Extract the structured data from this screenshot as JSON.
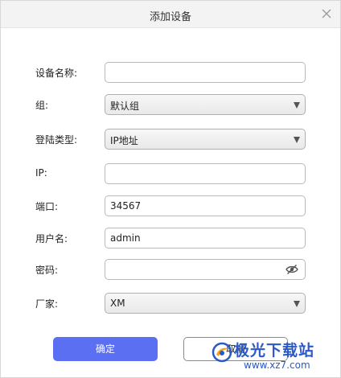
{
  "dialog": {
    "title": "添加设备"
  },
  "form": {
    "device_name": {
      "label": "设备名称:",
      "value": ""
    },
    "group": {
      "label": "组:",
      "value": "默认组"
    },
    "login_type": {
      "label": "登陆类型:",
      "value": "IP地址"
    },
    "ip": {
      "label": "IP:",
      "value": ""
    },
    "port": {
      "label": "端口:",
      "value": "34567"
    },
    "username": {
      "label": "用户名:",
      "value": "admin"
    },
    "password": {
      "label": "密码:",
      "value": ""
    },
    "vendor": {
      "label": "厂家:",
      "value": "XM"
    }
  },
  "buttons": {
    "ok_label": "确定",
    "cancel_label": "取消"
  },
  "watermark": {
    "text": "极光下载站",
    "url": "www.xz7.com"
  },
  "icons": {
    "close": "close-icon",
    "dropdown": "dropdown-arrow-icon",
    "password_toggle": "eye-slash-icon",
    "logo": "aurora-logo-icon"
  },
  "colors": {
    "primary": "#5a6ff2",
    "watermark": "#2b59c8"
  }
}
